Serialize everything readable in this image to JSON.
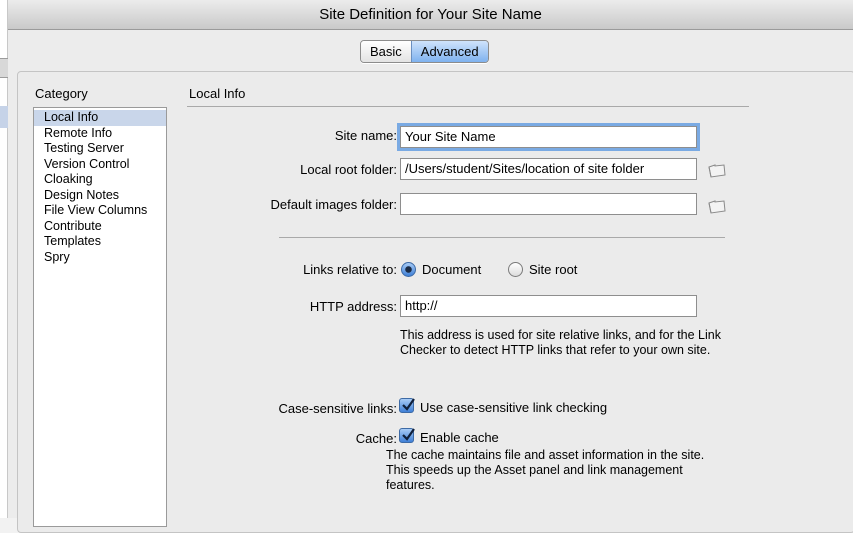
{
  "window": {
    "title": "Site Definition for Your Site Name"
  },
  "tabs": [
    {
      "label": "Basic"
    },
    {
      "label": "Advanced"
    }
  ],
  "category": {
    "label": "Category",
    "items": [
      {
        "label": "Local Info"
      },
      {
        "label": "Remote Info"
      },
      {
        "label": "Testing Server"
      },
      {
        "label": "Version Control"
      },
      {
        "label": "Cloaking"
      },
      {
        "label": "Design Notes"
      },
      {
        "label": "File View Columns"
      },
      {
        "label": "Contribute"
      },
      {
        "label": "Templates"
      },
      {
        "label": "Spry"
      }
    ]
  },
  "local_info": {
    "title": "Local Info",
    "site_name": {
      "label": "Site name:",
      "value": "Your Site Name"
    },
    "local_root": {
      "label": "Local root folder:",
      "value": "/Users/student/Sites/location of site folder"
    },
    "default_images": {
      "label": "Default images folder:",
      "value": ""
    },
    "links_relative": {
      "label": "Links relative to:",
      "options": [
        {
          "label": "Document",
          "checked": true
        },
        {
          "label": "Site root",
          "checked": false
        }
      ]
    },
    "http_address": {
      "label": "HTTP address:",
      "value": "http://",
      "note": "This address is used for site relative links, and for the Link Checker to detect HTTP links that refer to your own site."
    },
    "case_sensitive": {
      "label": "Case-sensitive links:",
      "checkbox_label": "Use case-sensitive link checking",
      "checked": true
    },
    "cache": {
      "label": "Cache:",
      "checkbox_label": "Enable cache",
      "checked": true,
      "note": "The cache maintains file and asset information in the site.  This speeds up the Asset panel and link management features."
    }
  },
  "icons": {
    "folder": "folder-icon",
    "check": "checkmark-icon"
  },
  "colors": {
    "accent": "#7fb2ef",
    "selection": "#c9d6ea",
    "focus": "#7aaae3"
  }
}
